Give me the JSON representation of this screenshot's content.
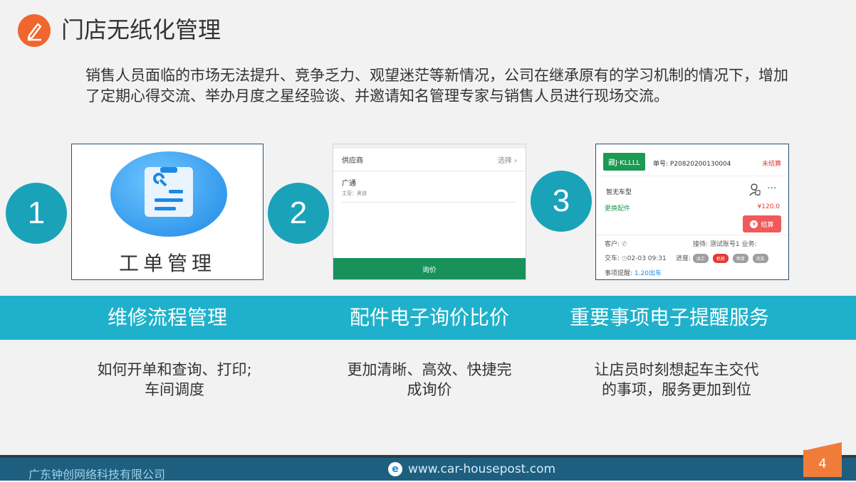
{
  "title": "门店无纸化管理",
  "intro": "销售人员面临的市场无法提升、竞争乏力、观望迷茫等新情况，公司在继承原有的学习机制的情况下，增加了定期心得交流、举办月度之星经验谈、并邀请知名管理专家与销售人员进行现场交流。",
  "steps": [
    {
      "num": "1",
      "band": "维修流程管理",
      "desc_line1": "如何开单和查询、打印;",
      "desc_line2": "车间调度"
    },
    {
      "num": "2",
      "band": "配件电子询价比价",
      "desc_line1": "更加清晰、高效、快捷完",
      "desc_line2": "成询价"
    },
    {
      "num": "3",
      "band": "重要事项电子提醒服务",
      "desc_line1": "让店员时刻想起车主交代",
      "desc_line2": "的事项，服务更加到位"
    }
  ],
  "card1": {
    "label": "工单管理",
    "icon": "wrench-clipboard-icon"
  },
  "card2": {
    "supplier_label": "供应商",
    "select_label": "选择",
    "supplier_name": "广通",
    "supplier_sub": "主营：奥迪",
    "button_label": "询价"
  },
  "card3": {
    "plate": "藏J·KLLLL",
    "order_no": "单号: P20820200130004",
    "status": "未结算",
    "car_model": "暂无车型",
    "part_label": "更换配件",
    "part_price": "¥120.0",
    "pay_label": "结算",
    "customer_label": "客户:",
    "receiver_label": "接待: 测试账号1 业务:",
    "delivery_label": "交车:",
    "delivery_time": "02-03 09:31",
    "progress_label": "进度:",
    "progress_steps": [
      "派工",
      "机修",
      "喷漆",
      "洗车"
    ],
    "reminder_label": "事项提醒:",
    "reminder_value": "1.20出车"
  },
  "footer": {
    "company": "广东钟创网络科技有限公司",
    "url": "www.car-housepost.com",
    "page": "4"
  },
  "colors": {
    "accent": "#1fb1cb",
    "orange": "#f0662e",
    "footer": "#1e5f80",
    "green": "#18915a"
  }
}
